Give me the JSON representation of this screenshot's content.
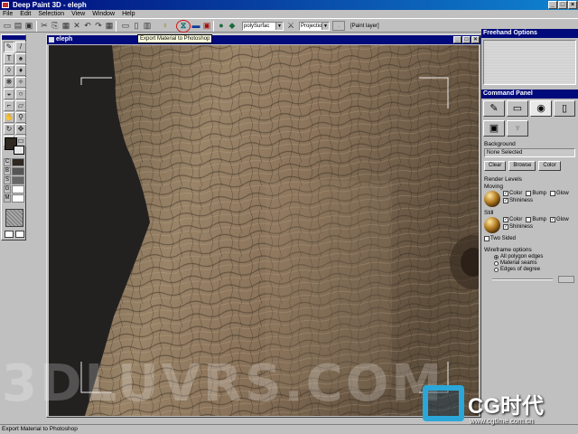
{
  "app": {
    "title": "Deep Paint 3D - eleph",
    "window_buttons": [
      "_",
      "□",
      "×"
    ]
  },
  "menu": [
    "File",
    "Edit",
    "Selection",
    "View",
    "Window",
    "Help"
  ],
  "toolbar": {
    "mapping_select": "polySurfac",
    "projection_select": "Projection",
    "layer_label": "[Paint layer]",
    "highlighted_tool": "export-material-to-photoshop",
    "tooltip": "Export Material to Photoshop"
  },
  "document": {
    "title": "eleph"
  },
  "freehand": {
    "title": "Freehand Options"
  },
  "command_panel": {
    "title": "Command Panel",
    "background_label": "Background",
    "background_value": "None Selected",
    "buttons": {
      "clear": "Clear",
      "browse": "Browse",
      "color": "Color"
    },
    "render_levels_label": "Render Levels",
    "moving_label": "Moving",
    "still_label": "Still",
    "color_label": "Color",
    "bump_label": "Bump",
    "glow_label": "Glow",
    "shininess_label": "Shininess",
    "two_sided_label": "Two Sided",
    "moving": {
      "color": true,
      "bump": false,
      "glow": false,
      "shininess": true
    },
    "still": {
      "color": true,
      "bump": false,
      "glow": true,
      "shininess": true
    },
    "two_sided": false,
    "wireframe_label": "Wireframe options",
    "wireframe_options": [
      "All polygon edges",
      "Material seams",
      "Edges of degree"
    ],
    "wireframe_selected": 0
  },
  "watermark": "3DLUVRS.COM",
  "logo": {
    "text": "CG时代",
    "url": "www.cgtime.com.cn"
  },
  "status": "Export Material to Photoshop",
  "colors": {
    "titlebar": "#000a7b",
    "chrome": "#c0c0c0",
    "highlight_ring": "#d01818"
  }
}
